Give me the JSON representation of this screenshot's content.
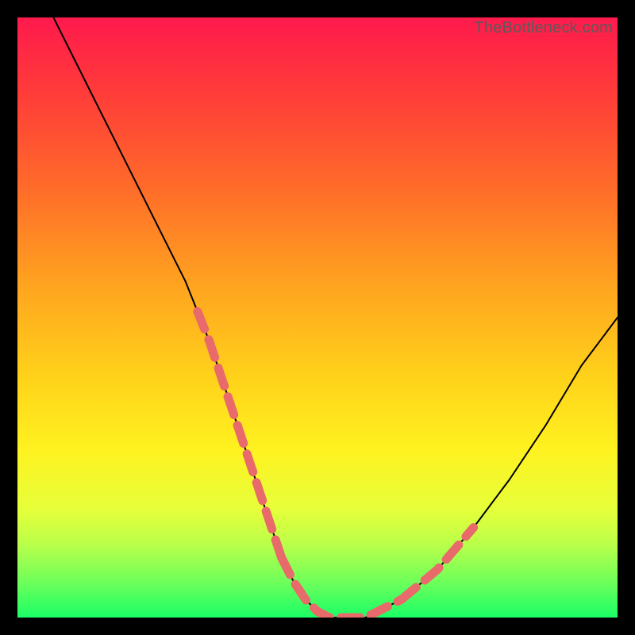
{
  "watermark": {
    "text": "TheBottleneck.com"
  },
  "colors": {
    "curve": "#000000",
    "dashed": "#e86a6a",
    "gradient_top": "#ff1a4d",
    "gradient_bottom": "#1aff66",
    "background": "#000000"
  },
  "chart_data": {
    "type": "line",
    "title": "",
    "xlabel": "",
    "ylabel": "",
    "xlim": [
      0,
      100
    ],
    "ylim": [
      0,
      100
    ],
    "grid": false,
    "legend": false,
    "series": [
      {
        "name": "bottleneck-curve",
        "x": [
          6,
          10,
          14,
          18,
          22,
          26,
          28,
          30,
          32,
          34,
          36,
          38,
          40,
          42,
          44,
          46,
          48,
          50,
          52,
          54,
          56,
          58,
          60,
          64,
          70,
          76,
          82,
          88,
          94,
          100
        ],
        "y": [
          100,
          92,
          84,
          76,
          68,
          60,
          56,
          51,
          46,
          40,
          34,
          28,
          22,
          16,
          10,
          6,
          3,
          1,
          0,
          0,
          0,
          0,
          1,
          3,
          8,
          15,
          23,
          32,
          42,
          50
        ]
      }
    ],
    "highlight_dashed_segments": [
      {
        "name": "left-descent-dashed",
        "x": [
          30,
          32,
          34,
          36,
          38,
          40,
          42,
          44
        ],
        "y": [
          51,
          46,
          40,
          34,
          28,
          22,
          16,
          10
        ]
      },
      {
        "name": "valley-dashed",
        "x": [
          44,
          46,
          48,
          50,
          52,
          54,
          56,
          58,
          60,
          64
        ],
        "y": [
          10,
          6,
          3,
          1,
          0,
          0,
          0,
          0,
          1,
          3
        ]
      },
      {
        "name": "right-rise-dashed",
        "x": [
          64,
          70,
          76
        ],
        "y": [
          3,
          8,
          15
        ]
      }
    ],
    "annotations": []
  }
}
